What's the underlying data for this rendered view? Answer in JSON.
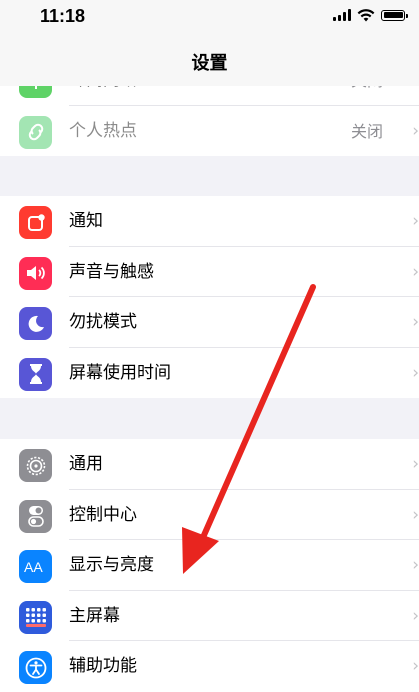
{
  "status": {
    "time": "11:18"
  },
  "nav": {
    "title": "设置"
  },
  "group1": [
    {
      "label": "蜂窝网络",
      "value": "关闭"
    },
    {
      "label": "个人热点",
      "value": "关闭"
    }
  ],
  "group2": [
    {
      "label": "通知"
    },
    {
      "label": "声音与触感"
    },
    {
      "label": "勿扰模式"
    },
    {
      "label": "屏幕使用时间"
    }
  ],
  "group3": [
    {
      "label": "通用"
    },
    {
      "label": "控制中心"
    },
    {
      "label": "显示与亮度"
    },
    {
      "label": "主屏幕"
    },
    {
      "label": "辅助功能"
    }
  ],
  "colors": {
    "cellular": "#5fd367",
    "hotspot": "#34c759",
    "notifications": "#ff3b30",
    "sounds": "#ff2d55",
    "dnd": "#5856d6",
    "screentime": "#5856d6",
    "general": "#8e8e93",
    "control": "#8e8e93",
    "display": "#0a84ff",
    "homescreen": "#2f5bdc",
    "accessibility": "#0a84ff",
    "annotation_arrow": "#e8251f"
  },
  "chevron": "›"
}
